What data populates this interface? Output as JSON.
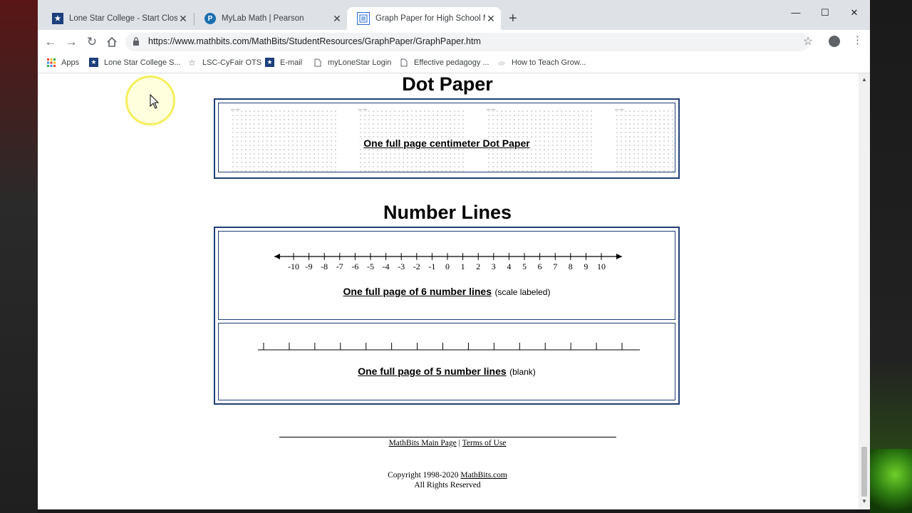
{
  "tabs": [
    {
      "title": "Lone Star College - Start Close. C",
      "icon": "star-icon",
      "color": "#1c3f7c",
      "active": false
    },
    {
      "title": "MyLab Math | Pearson",
      "icon": "pearson-icon",
      "color": "#1a6fb0",
      "active": false
    },
    {
      "title": "Graph Paper for High School Mat",
      "icon": "page-icon",
      "color": "#2a6bd1",
      "active": true
    }
  ],
  "toolbar": {
    "url": "https://www.mathbits.com/MathBits/StudentResources/GraphPaper/GraphPaper.htm",
    "new_tab_glyph": "+",
    "minimize_glyph": "—",
    "maximize_glyph": "☐",
    "close_glyph": "✕"
  },
  "bookmarks": [
    {
      "label": "Apps",
      "icon": "apps-grid-icon"
    },
    {
      "label": "Lone Star College S...",
      "icon": "star-icon"
    },
    {
      "label": "LSC-CyFair OTS",
      "icon": "star-outline-icon"
    },
    {
      "label": "E-mail",
      "icon": "star-icon"
    },
    {
      "label": "myLoneStar Login",
      "icon": "document-icon"
    },
    {
      "label": "Effective pedagogy ...",
      "icon": "document-icon"
    },
    {
      "label": "How to Teach Grow...",
      "icon": "cloud-icon"
    }
  ],
  "dot_paper": {
    "title": "Dot Paper",
    "link": "One full page centimeter Dot Paper"
  },
  "number_lines": {
    "title": "Number Lines",
    "scaled": {
      "link": "One full page of 6 number lines",
      "note": "(scale labeled)",
      "ticks": [
        "-10",
        "-9",
        "-8",
        "-7",
        "-6",
        "-5",
        "-4",
        "-3",
        "-2",
        "-1",
        "0",
        "1",
        "2",
        "3",
        "4",
        "5",
        "6",
        "7",
        "8",
        "9",
        "10"
      ]
    },
    "blank": {
      "link": "One full page of 5 number lines",
      "note": "(blank)",
      "tick_count": 15
    }
  },
  "footer": {
    "main_link": "MathBits Main Page",
    "separator": "|",
    "terms_link": "Terms of Use",
    "copyright": "Copyright 1998-2020",
    "copyright_link": "MathBits.com",
    "rights": "All Rights Reserved"
  }
}
